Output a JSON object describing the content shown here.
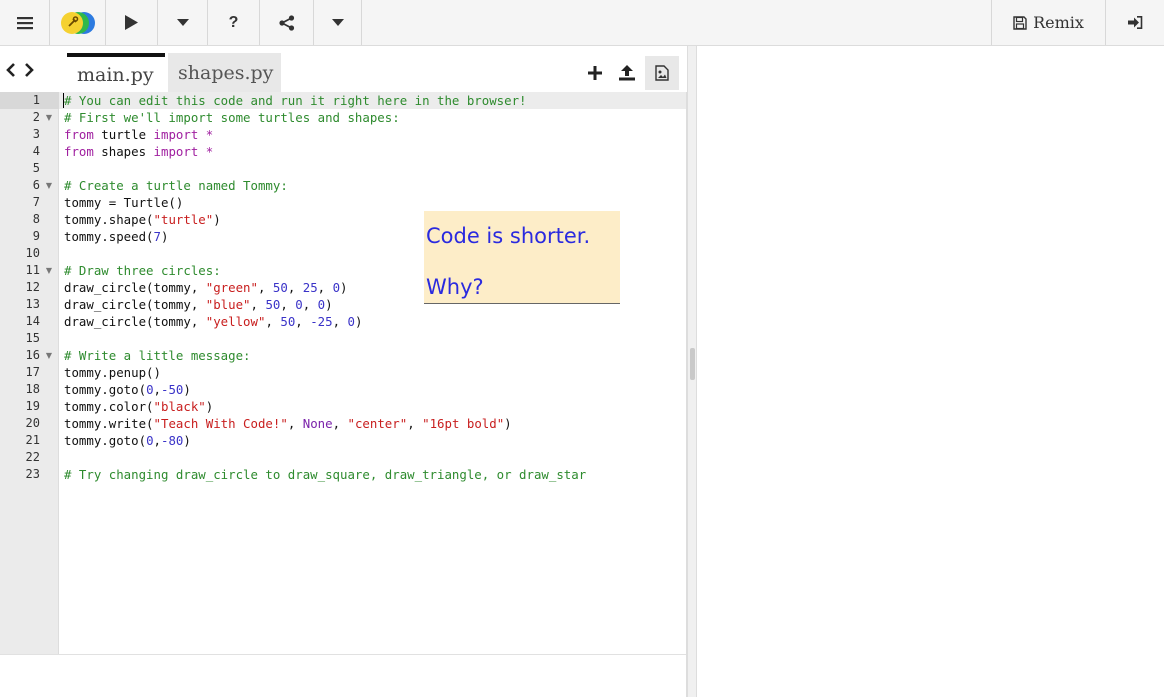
{
  "toolbar": {
    "menu_icon": "hamburger-menu-icon",
    "logo_icon": "trinket-logo-icon",
    "run_icon": "play-icon",
    "help_label": "?",
    "share_icon": "share-icon",
    "remix_label": "Remix",
    "login_icon": "sign-in-icon"
  },
  "tabs": [
    {
      "label": "main.py",
      "active": true
    },
    {
      "label": "shapes.py",
      "active": false
    }
  ],
  "tab_tools": [
    "add-file-icon",
    "upload-icon",
    "image-icon"
  ],
  "code": {
    "line_numbers": [
      "1",
      "2",
      "3",
      "4",
      "5",
      "6",
      "7",
      "8",
      "9",
      "10",
      "11",
      "12",
      "13",
      "14",
      "15",
      "16",
      "17",
      "18",
      "19",
      "20",
      "21",
      "22",
      "23"
    ],
    "fold_lines": [
      2,
      6,
      11,
      16
    ]
  },
  "note": {
    "line1": "Code is shorter.",
    "line2": "Why?"
  },
  "colors": {
    "comment": "#2e8b2e",
    "keyword": "#a020a0",
    "string": "#c81e1e",
    "number": "#3a33c8",
    "note_bg": "#fdedc8",
    "note_text": "#2a2adf"
  }
}
